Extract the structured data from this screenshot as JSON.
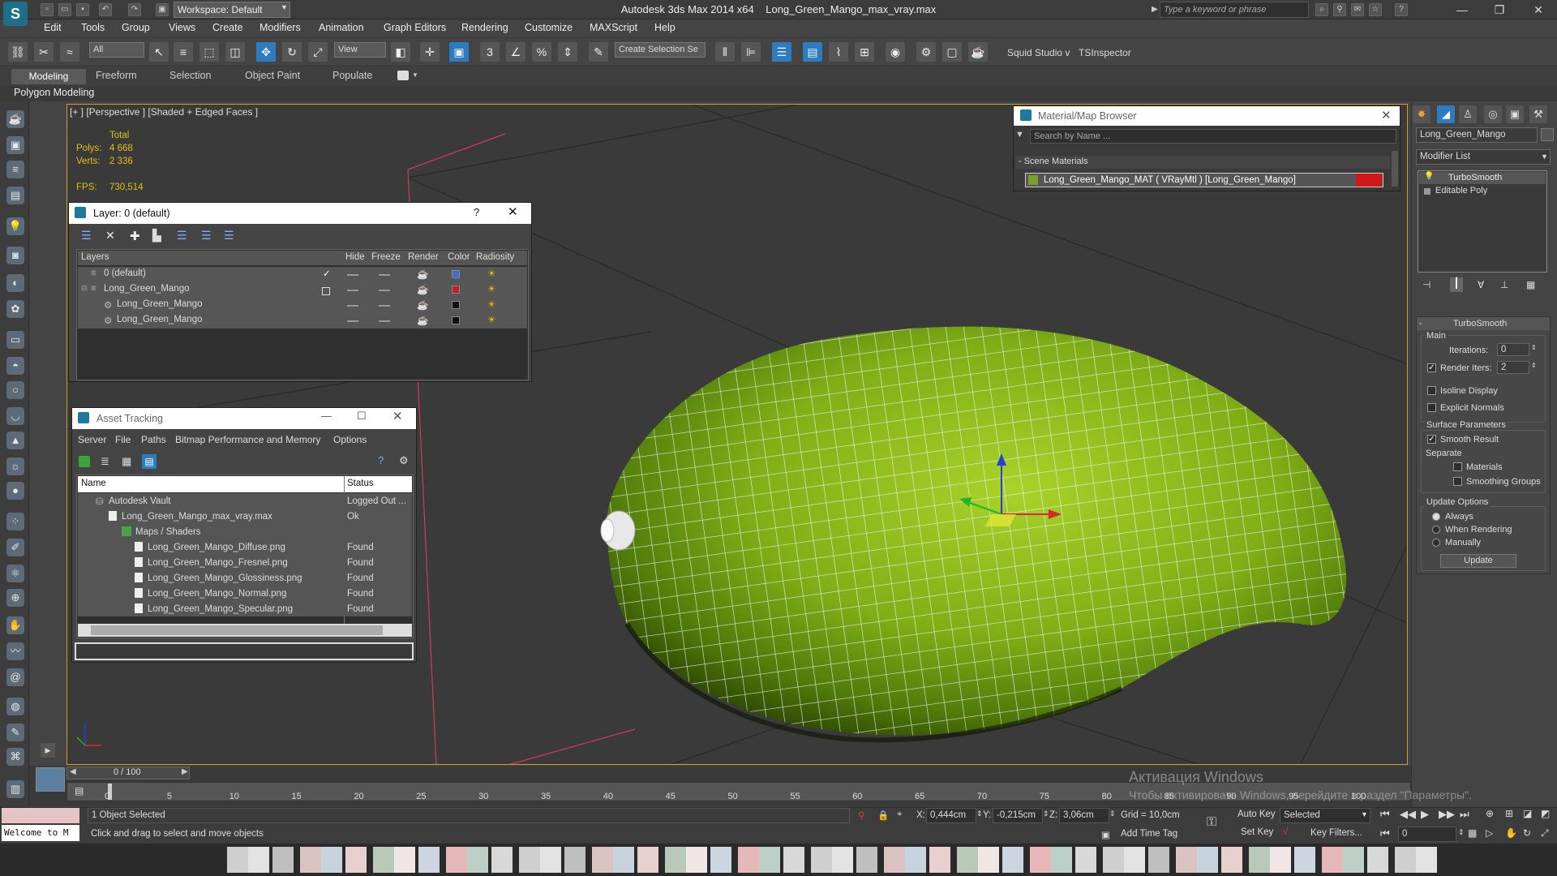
{
  "title": {
    "workspace": "Workspace: Default",
    "app_title": "Autodesk 3ds Max  2014 x64",
    "file_title": "Long_Green_Mango_max_vray.max",
    "search_placeholder": "Type a keyword or phrase"
  },
  "menu": [
    "Edit",
    "Tools",
    "Group",
    "Views",
    "Create",
    "Modifiers",
    "Animation",
    "Graph Editors",
    "Rendering",
    "Customize",
    "MAXScript",
    "Help"
  ],
  "toolbar": {
    "filter": "All",
    "ref_coord": "View",
    "selection_set": "Create Selection Se",
    "squid": "Squid Studio v",
    "tsinspector": "TSInspector"
  },
  "ribbon": {
    "tabs": [
      "Modeling",
      "Freeform",
      "Selection",
      "Object Paint",
      "Populate"
    ],
    "sub": "Polygon Modeling"
  },
  "viewport": {
    "label": "[+ ] [Perspective ] [Shaded + Edged Faces ]",
    "stats_total": "Total",
    "polys_label": "Polys:",
    "polys": "4 668",
    "verts_label": "Verts:",
    "verts": "2 336",
    "fps_label": "FPS:",
    "fps": "730,514"
  },
  "layer_dialog": {
    "title": "Layer: 0 (default)",
    "help": "?",
    "columns": [
      "Layers",
      "Hide",
      "Freeze",
      "Render",
      "Color",
      "Radiosity"
    ],
    "rows": [
      {
        "name": "0 (default)",
        "color": "#3a6fd0"
      },
      {
        "name": "Long_Green_Mango",
        "color": "#c81e1e"
      },
      {
        "name": "Long_Green_Mango",
        "color": "#111111"
      },
      {
        "name": "Long_Green_Mango",
        "color": "#111111"
      }
    ]
  },
  "asset_tracking": {
    "title": "Asset Tracking",
    "menu": [
      "Server",
      "File",
      "Paths",
      "Bitmap Performance and Memory",
      "Options"
    ],
    "columns": [
      "Name",
      "Status"
    ],
    "rows": [
      {
        "name": "Autodesk Vault",
        "status": "Logged Out ..."
      },
      {
        "name": "Long_Green_Mango_max_vray.max",
        "status": "Ok"
      },
      {
        "name": "Maps / Shaders",
        "status": ""
      },
      {
        "name": "Long_Green_Mango_Diffuse.png",
        "status": "Found"
      },
      {
        "name": "Long_Green_Mango_Fresnel.png",
        "status": "Found"
      },
      {
        "name": "Long_Green_Mango_Glossiness.png",
        "status": "Found"
      },
      {
        "name": "Long_Green_Mango_Normal.png",
        "status": "Found"
      },
      {
        "name": "Long_Green_Mango_Specular.png",
        "status": "Found"
      }
    ]
  },
  "material_browser": {
    "title": "Material/Map Browser",
    "search_placeholder": "Search by Name ...",
    "section": "- Scene Materials",
    "item": "Long_Green_Mango_MAT  ( VRayMtl )  [Long_Green_Mango]"
  },
  "command_panel": {
    "object_name": "Long_Green_Mango",
    "modifier_list": "Modifier List",
    "stack": [
      "TurboSmooth",
      "Editable Poly"
    ],
    "rollout_title": "TurboSmooth",
    "main_label": "Main",
    "iterations_label": "Iterations:",
    "iterations": "0",
    "render_iters_label": "Render Iters:",
    "render_iters": "2",
    "isoline": "Isoline Display",
    "explicit_normals": "Explicit Normals",
    "surface_params": "Surface Parameters",
    "smooth_result": "Smooth Result",
    "separate": "Separate",
    "materials": "Materials",
    "smoothing_groups": "Smoothing Groups",
    "update_options": "Update Options",
    "always": "Always",
    "when_rendering": "When Rendering",
    "manually": "Manually",
    "update_button": "Update"
  },
  "timeline": {
    "frame": "0 / 100",
    "ticks": [
      "0",
      "5",
      "10",
      "15",
      "20",
      "25",
      "30",
      "35",
      "40",
      "45",
      "50",
      "55",
      "60",
      "65",
      "70",
      "75",
      "80",
      "85",
      "90",
      "95",
      "100"
    ]
  },
  "watermark": {
    "line1": "Активация Windows",
    "line2": "Чтобы активировать Windows, перейдите в раздел \"Параметры\"."
  },
  "status": {
    "listener": "Welcome to M",
    "selected": "1 Object Selected",
    "prompt": "Click and drag to select and move objects",
    "x_label": "X:",
    "x": "0,444cm",
    "y_label": "Y:",
    "y": "-0,215cm",
    "z_label": "Z:",
    "z": "3,06cm",
    "grid": "Grid = 10,0cm",
    "add_time_tag": "Add Time Tag",
    "auto_key": "Auto Key",
    "set_key": "Set Key",
    "selected_dd": "Selected",
    "key_filters": "Key Filters...",
    "frame_field": "0"
  }
}
